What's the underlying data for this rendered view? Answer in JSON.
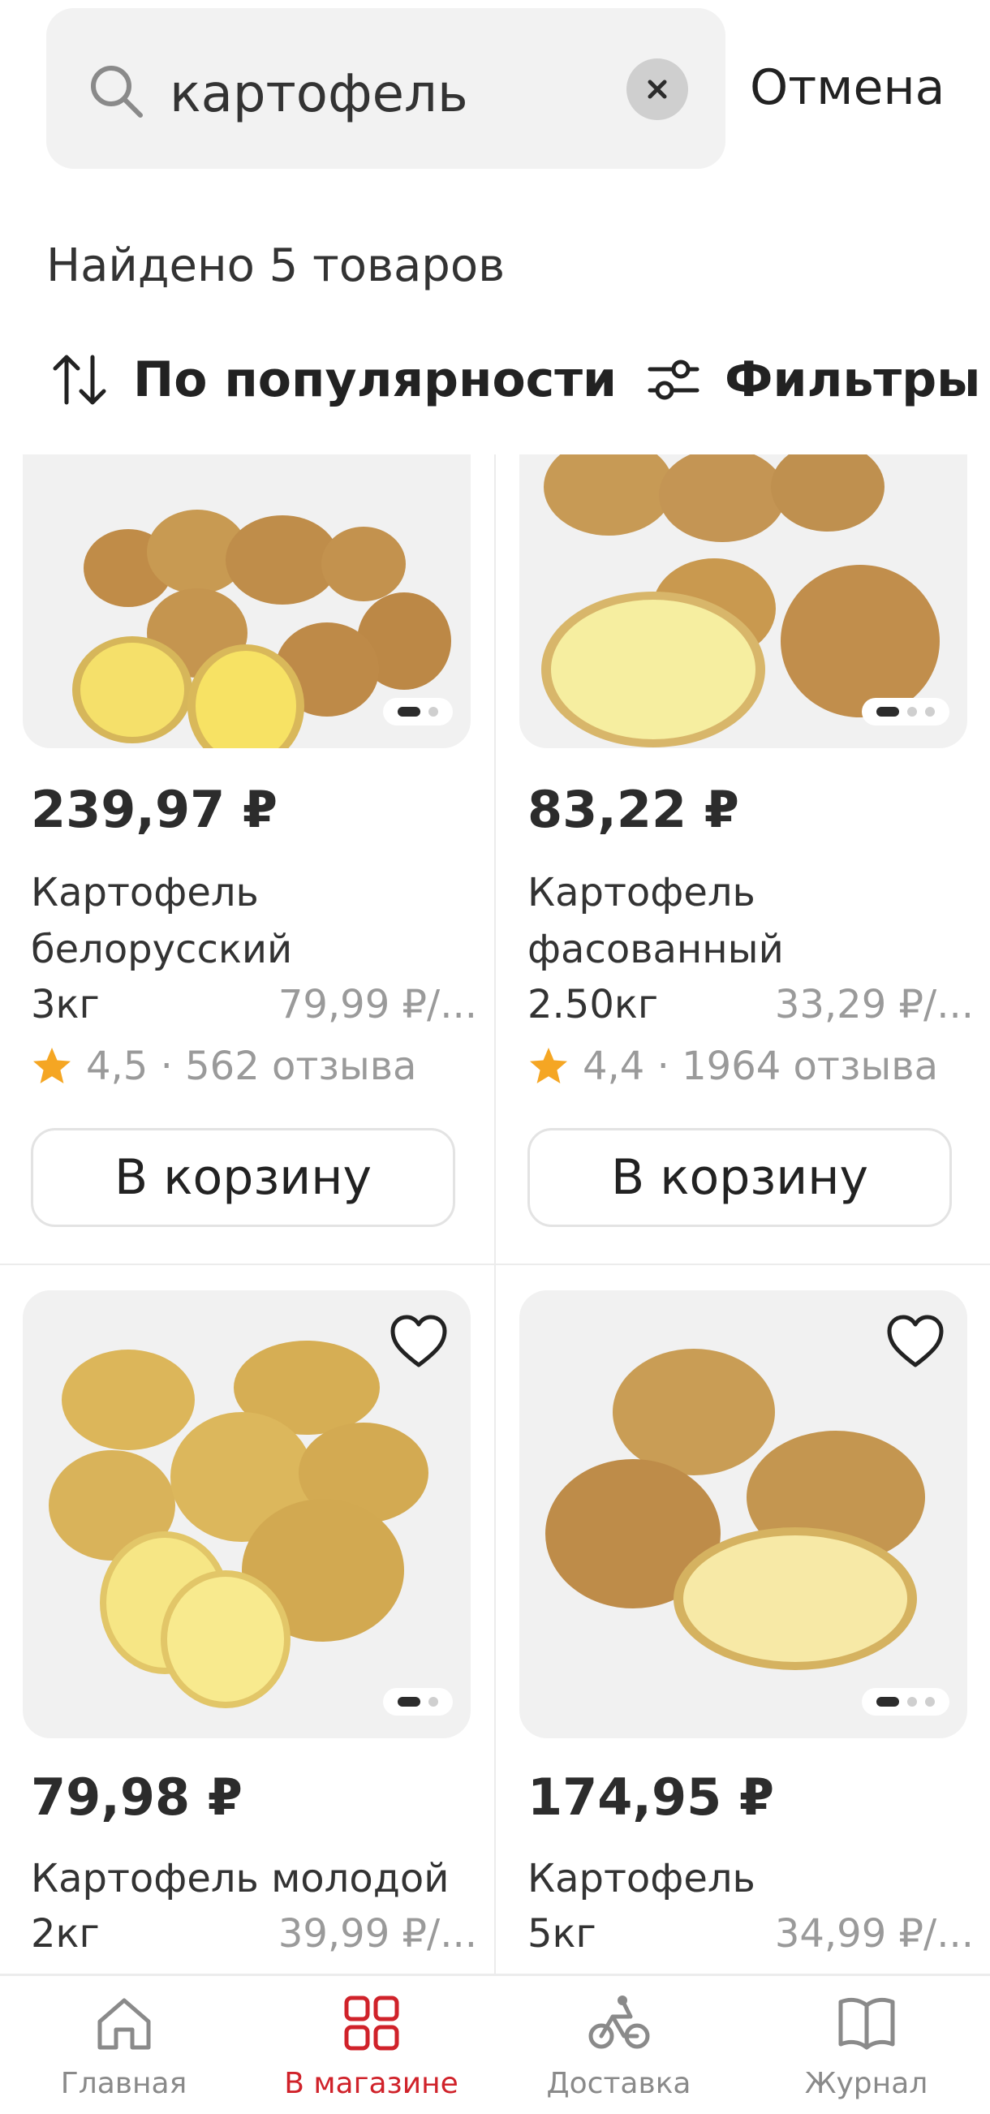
{
  "search": {
    "value": "картофель",
    "cancel_label": "Отмена"
  },
  "results": {
    "found_text": "Найдено 5 товаров"
  },
  "toolbar": {
    "sort_label": "По популярности",
    "filter_label": "Фильтры"
  },
  "products": [
    {
      "price": "239,97 ₽",
      "name": "Картофель белорусский",
      "weight": "3кг",
      "unit_price": "79,99 ₽/...",
      "rating": "4,5 · 562 отзыва",
      "cart_label": "В корзину",
      "image_dots": 2
    },
    {
      "price": "83,22 ₽",
      "name": "Картофель фасованный",
      "weight": "2.50кг",
      "unit_price": "33,29 ₽/...",
      "rating": "4,4 · 1964 отзыва",
      "cart_label": "В корзину",
      "image_dots": 3
    },
    {
      "price": "79,98 ₽",
      "name": "Картофель молодой",
      "weight": "2кг",
      "unit_price": "39,99 ₽/...",
      "image_dots": 2
    },
    {
      "price": "174,95 ₽",
      "name": "Картофель",
      "weight": "5кг",
      "unit_price": "34,99 ₽/...",
      "image_dots": 3
    }
  ],
  "nav": {
    "items": [
      {
        "label": "Главная",
        "icon": "home-icon",
        "active": false
      },
      {
        "label": "В магазине",
        "icon": "grid-icon",
        "active": true
      },
      {
        "label": "Доставка",
        "icon": "bike-icon",
        "active": false
      },
      {
        "label": "Журнал",
        "icon": "book-icon",
        "active": false
      }
    ]
  },
  "colors": {
    "accent": "#d0222a",
    "star": "#f5a623",
    "potato_skin": "#c89a4e",
    "potato_flesh": "#f3df7a"
  }
}
